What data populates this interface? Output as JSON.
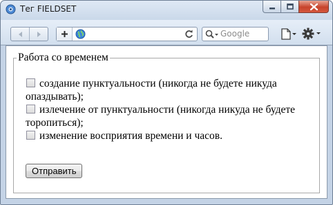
{
  "window": {
    "title": "Тег FIELDSET"
  },
  "toolbar": {
    "search_placeholder": "Google"
  },
  "form": {
    "legend": "Работа со временем",
    "options": [
      {
        "label": "создание пунктуальности (никогда не будете никуда опаздывать);",
        "checked": false
      },
      {
        "label": "излечение от пунктуальности (никогда никуда не будете торопиться);",
        "checked": false
      },
      {
        "label": "изменение восприятия времени и часов.",
        "checked": false
      }
    ],
    "submit_label": "Отправить"
  },
  "icons": {
    "app": "browser-icon",
    "minimize": "minimize-icon",
    "maximize": "maximize-icon",
    "close": "close-icon",
    "back": "back-arrow-icon",
    "forward": "forward-arrow-icon",
    "add_bookmark": "plus-icon",
    "site": "globe-icon",
    "reload": "reload-icon",
    "search": "search-icon",
    "page_menu": "page-icon",
    "settings_menu": "gear-icon"
  },
  "colors": {
    "close_button": "#c7432b",
    "chrome": "#cbd9ea"
  }
}
